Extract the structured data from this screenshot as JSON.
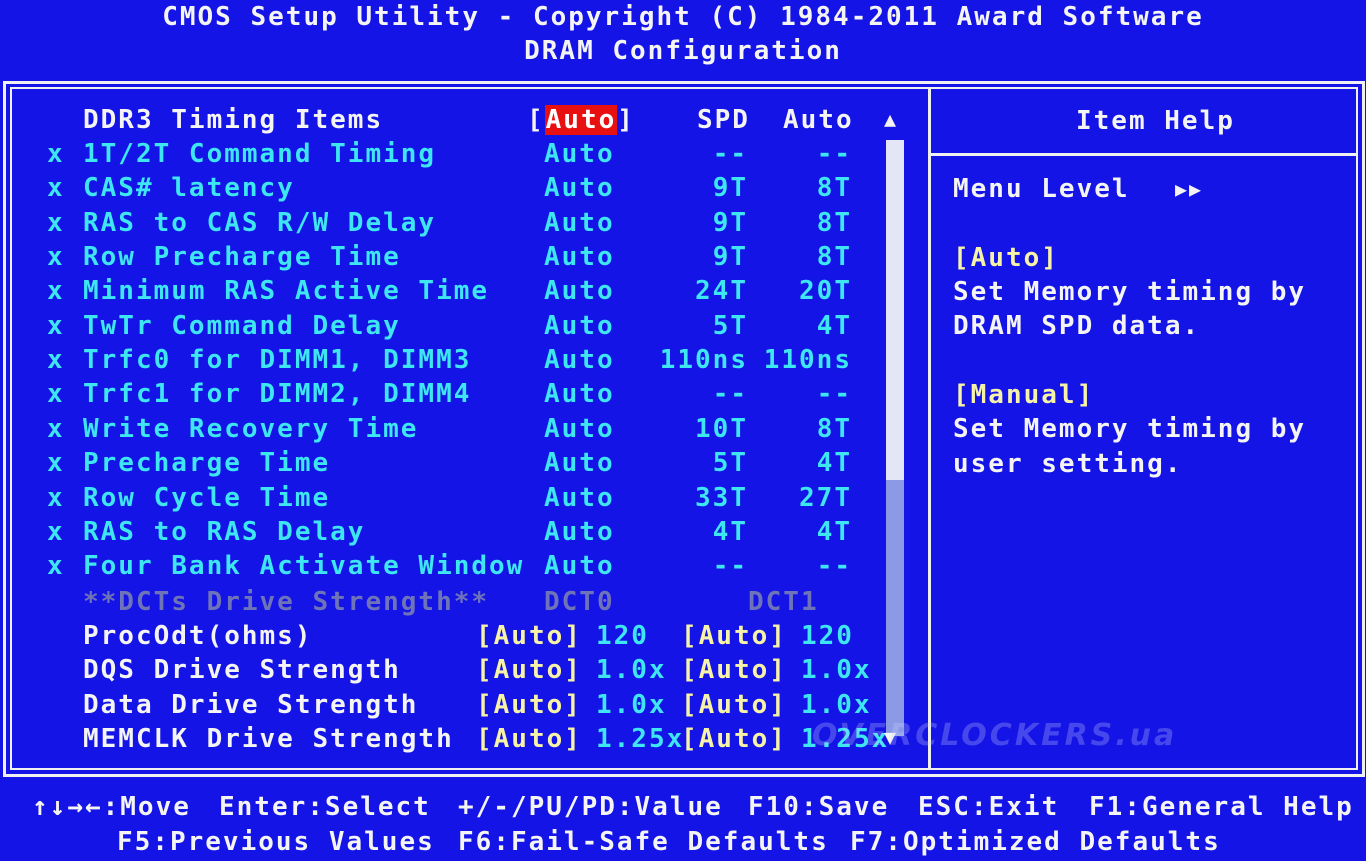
{
  "header": {
    "title": "CMOS Setup Utility - Copyright (C) 1984-2011 Award Software",
    "subtitle": "DRAM Configuration"
  },
  "timing_header": {
    "label": "DDR3 Timing Items",
    "value_open": "[",
    "value": "Auto",
    "value_close": "]",
    "col_spd": "SPD",
    "col_auto": "Auto"
  },
  "timing_items": [
    {
      "marker": "x",
      "label": "1T/2T Command Timing",
      "value": "Auto",
      "spd": "--",
      "auto": "--"
    },
    {
      "marker": "x",
      "label": "CAS# latency",
      "value": "Auto",
      "spd": "9T",
      "auto": "8T"
    },
    {
      "marker": "x",
      "label": "RAS to CAS R/W Delay",
      "value": "Auto",
      "spd": "9T",
      "auto": "8T"
    },
    {
      "marker": "x",
      "label": "Row Precharge Time",
      "value": "Auto",
      "spd": "9T",
      "auto": "8T"
    },
    {
      "marker": "x",
      "label": "Minimum RAS Active Time",
      "value": "Auto",
      "spd": "24T",
      "auto": "20T"
    },
    {
      "marker": "x",
      "label": "TwTr Command Delay",
      "value": "Auto",
      "spd": "5T",
      "auto": "4T"
    },
    {
      "marker": "x",
      "label": "Trfc0 for DIMM1, DIMM3",
      "value": "Auto",
      "spd": "110ns",
      "auto": "110ns"
    },
    {
      "marker": "x",
      "label": "Trfc1 for DIMM2, DIMM4",
      "value": "Auto",
      "spd": "--",
      "auto": "--"
    },
    {
      "marker": "x",
      "label": "Write Recovery Time",
      "value": "Auto",
      "spd": "10T",
      "auto": "8T"
    },
    {
      "marker": "x",
      "label": "Precharge Time",
      "value": "Auto",
      "spd": "5T",
      "auto": "4T"
    },
    {
      "marker": "x",
      "label": "Row Cycle Time",
      "value": "Auto",
      "spd": "33T",
      "auto": "27T"
    },
    {
      "marker": "x",
      "label": "RAS to RAS Delay",
      "value": "Auto",
      "spd": "4T",
      "auto": "4T"
    },
    {
      "marker": "x",
      "label": "Four Bank Activate Window",
      "value": "Auto",
      "spd": "--",
      "auto": "--"
    }
  ],
  "dct_header": {
    "label": "**DCTs Drive Strength**",
    "dct0": "DCT0",
    "dct1": "DCT1"
  },
  "drive_items": [
    {
      "label": "ProcOdt(ohms)",
      "dct0_setting": "[Auto]",
      "dct0_value": "120",
      "dct1_setting": "[Auto]",
      "dct1_value": "120"
    },
    {
      "label": "DQS Drive Strength",
      "dct0_setting": "[Auto]",
      "dct0_value": "1.0x",
      "dct1_setting": "[Auto]",
      "dct1_value": "1.0x"
    },
    {
      "label": "Data Drive Strength",
      "dct0_setting": "[Auto]",
      "dct0_value": "1.0x",
      "dct1_setting": "[Auto]",
      "dct1_value": "1.0x"
    },
    {
      "label": "MEMCLK Drive Strength",
      "dct0_setting": "[Auto]",
      "dct0_value": "1.25x",
      "dct1_setting": "[Auto]",
      "dct1_value": "1.25x"
    }
  ],
  "help": {
    "title": "Item Help",
    "menu_level_label": "Menu Level",
    "menu_level_arrows": "▶▶",
    "option1_name": "[Auto]",
    "option1_line1": "Set Memory timing by",
    "option1_line2": "DRAM SPD data.",
    "option2_name": "[Manual]",
    "option2_line1": "Set Memory timing by",
    "option2_line2": "user setting."
  },
  "scrollbar": {
    "up_arrow": "▲",
    "down_arrow": "▼",
    "visible_fraction": 0.57
  },
  "footer": {
    "move": "↑↓→←:Move",
    "enter": "Enter:Select",
    "value": "+/-/PU/PD:Value",
    "save": "F10:Save",
    "exit": "ESC:Exit",
    "general_help": "F1:General Help",
    "previous": "F5:Previous Values",
    "failsafe": "F6:Fail-Safe Defaults",
    "optimized": "F7:Optimized Defaults"
  },
  "watermark": "OVERCLOCKERS.ua",
  "colors": {
    "background": "#1414e6",
    "text_white": "#f4f4f4",
    "text_cyan": "#3ee6f2",
    "text_disabled": "#6f74b8",
    "text_yellow": "#f6f2a8",
    "highlight": "#e81010"
  }
}
